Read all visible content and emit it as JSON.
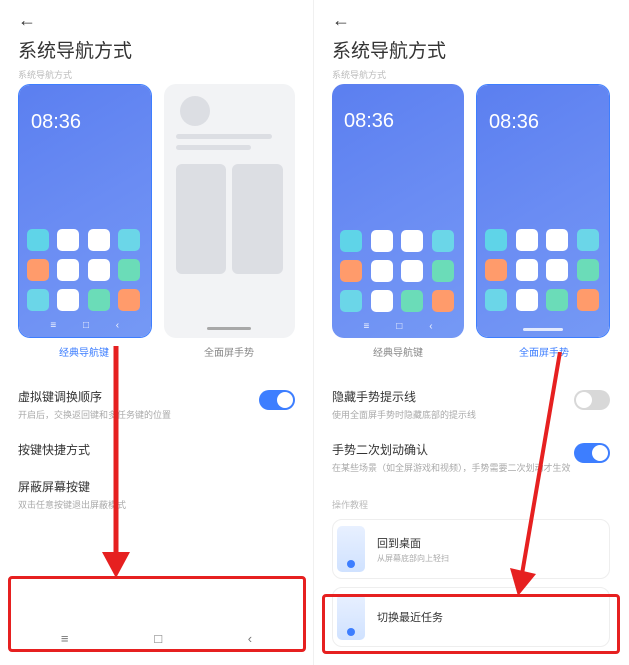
{
  "left": {
    "title": "系统导航方式",
    "section": "系统导航方式",
    "time": "08:36",
    "previewLabels": {
      "classic": "经典导航键",
      "gesture": "全面屏手势"
    },
    "settings": [
      {
        "title": "虚拟键调换顺序",
        "desc": "开启后，交换返回键和多任务键的位置",
        "toggle": "on"
      },
      {
        "title": "按键快捷方式",
        "desc": "",
        "toggle": null
      },
      {
        "title": "屏蔽屏幕按键",
        "desc": "双击任意按键退出屏蔽模式",
        "toggle": null
      }
    ]
  },
  "right": {
    "title": "系统导航方式",
    "section": "系统导航方式",
    "time": "08:36",
    "previewLabels": {
      "classic": "经典导航键",
      "gesture": "全面屏手势"
    },
    "settings": [
      {
        "title": "隐藏手势提示线",
        "desc": "使用全面屏手势时隐藏底部的提示线",
        "toggle": "off"
      },
      {
        "title": "手势二次划动确认",
        "desc": "在某些场景（如全屏游戏和视频），手势需要二次划动才生效",
        "toggle": "on"
      }
    ],
    "tutorialLabel": "操作教程",
    "tutorials": [
      {
        "title": "回到桌面",
        "desc": "从屏幕底部向上轻扫"
      },
      {
        "title": "切换最近任务",
        "desc": ""
      }
    ]
  },
  "appColors": [
    "#5fd4e8",
    "#ffffff",
    "#ffffff",
    "#6bd6e8",
    "#ff9b6b",
    "#ffffff",
    "#ffffff",
    "#6bdcb8",
    "#6bd6e8",
    "#ffffff",
    "#6bdcb8",
    "#ff9b6b"
  ]
}
